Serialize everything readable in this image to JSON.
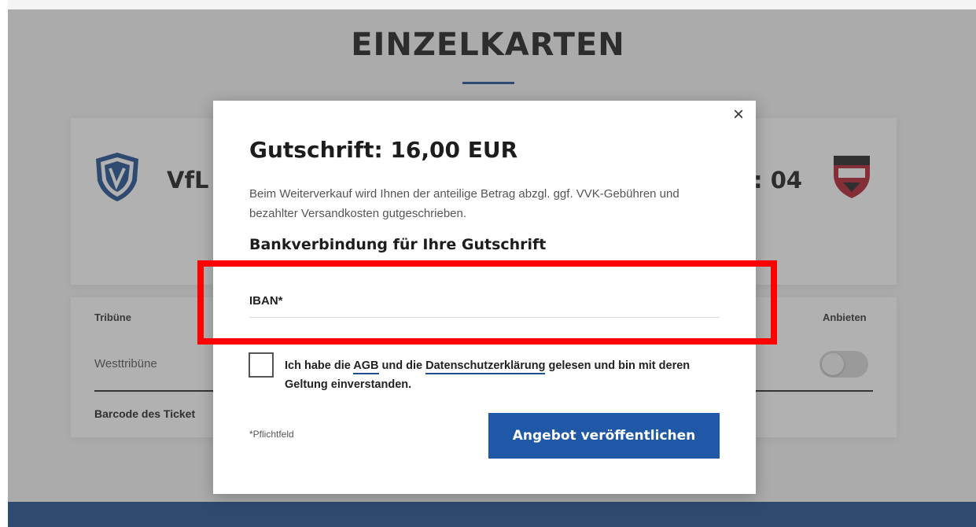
{
  "page": {
    "title": "EINZELKARTEN",
    "match": {
      "home_team_visible": "VfL",
      "away_team_visible": ": 04"
    },
    "table": {
      "col_tribune": "Tribüne",
      "col_offer": "Anbieten",
      "row_tribune": "Westtribüne",
      "barcode_label": "Barcode des Ticket"
    }
  },
  "modal": {
    "close_label": "×",
    "title": "Gutschrift: 16,00 EUR",
    "description": "Beim Weiterverkauf wird Ihnen der anteilige Betrag abzgl. ggf. VVK-Gebühren und bezahlter Versandkosten gutgeschrieben.",
    "subtitle": "Bankverbindung für Ihre Gutschrift",
    "iban_label": "IBAN*",
    "iban_value": "",
    "agree": {
      "text_1": "Ich habe die ",
      "link_agb": "AGB",
      "text_2": " und die ",
      "link_privacy": "Datenschutzerklärung",
      "text_3": " gelesen und bin mit deren Geltung einverstanden."
    },
    "required_note": "*Pflichtfeld",
    "publish_button": "Angebot veröffentlichen"
  },
  "colors": {
    "accent": "#1e58a6",
    "footer": "#1f4f8f",
    "highlight": "#ff0000"
  },
  "icons": [
    "vfl-bochum-crest-icon",
    "fc-ingolstadt-crest-icon",
    "close-icon",
    "checkbox-icon"
  ]
}
